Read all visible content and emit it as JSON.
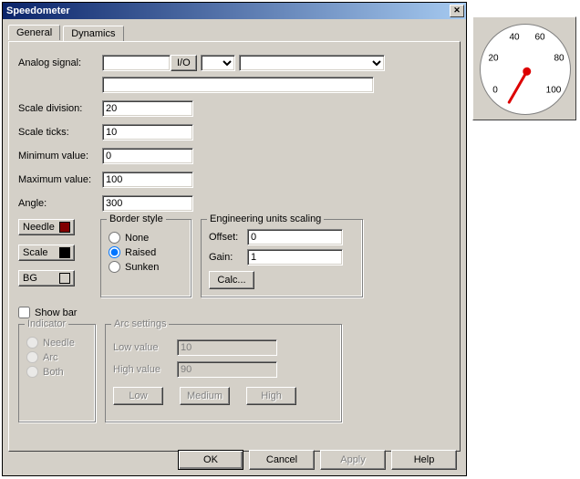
{
  "title": "Speedometer",
  "tabs": {
    "general": "General",
    "dynamics": "Dynamics"
  },
  "fields": {
    "analog_signal_label": "Analog signal:",
    "analog_signal_value": "",
    "io_button": "I/O",
    "scale_division_label": "Scale division:",
    "scale_division_value": "20",
    "scale_ticks_label": "Scale ticks:",
    "scale_ticks_value": "10",
    "min_value_label": "Minimum value:",
    "min_value_value": "0",
    "max_value_label": "Maximum value:",
    "max_value_value": "100",
    "angle_label": "Angle:",
    "angle_value": "300"
  },
  "colors": {
    "needle_label": "Needle",
    "needle_swatch": "#800000",
    "scale_label": "Scale",
    "scale_swatch": "#000000",
    "bg_label": "BG",
    "bg_swatch": "#d4d0c8"
  },
  "border_style": {
    "legend": "Border style",
    "none": "None",
    "raised": "Raised",
    "sunken": "Sunken"
  },
  "eng_units": {
    "legend": "Engineering units scaling",
    "offset_label": "Offset:",
    "offset_value": "0",
    "gain_label": "Gain:",
    "gain_value": "1",
    "calc_button": "Calc..."
  },
  "show_bar_label": "Show bar",
  "indicator": {
    "legend": "Indicator",
    "needle": "Needle",
    "arc": "Arc",
    "both": "Both"
  },
  "arc": {
    "legend": "Arc settings",
    "low_value_label": "Low value",
    "low_value": "10",
    "high_value_label": "High value",
    "high_value": "90",
    "low_btn": "Low",
    "medium_btn": "Medium",
    "high_btn": "High"
  },
  "buttons": {
    "ok": "OK",
    "cancel": "Cancel",
    "apply": "Apply",
    "help": "Help"
  },
  "gauge_labels": {
    "t0": "0",
    "t20": "20",
    "t40": "40",
    "t60": "60",
    "t80": "80",
    "t100": "100"
  }
}
